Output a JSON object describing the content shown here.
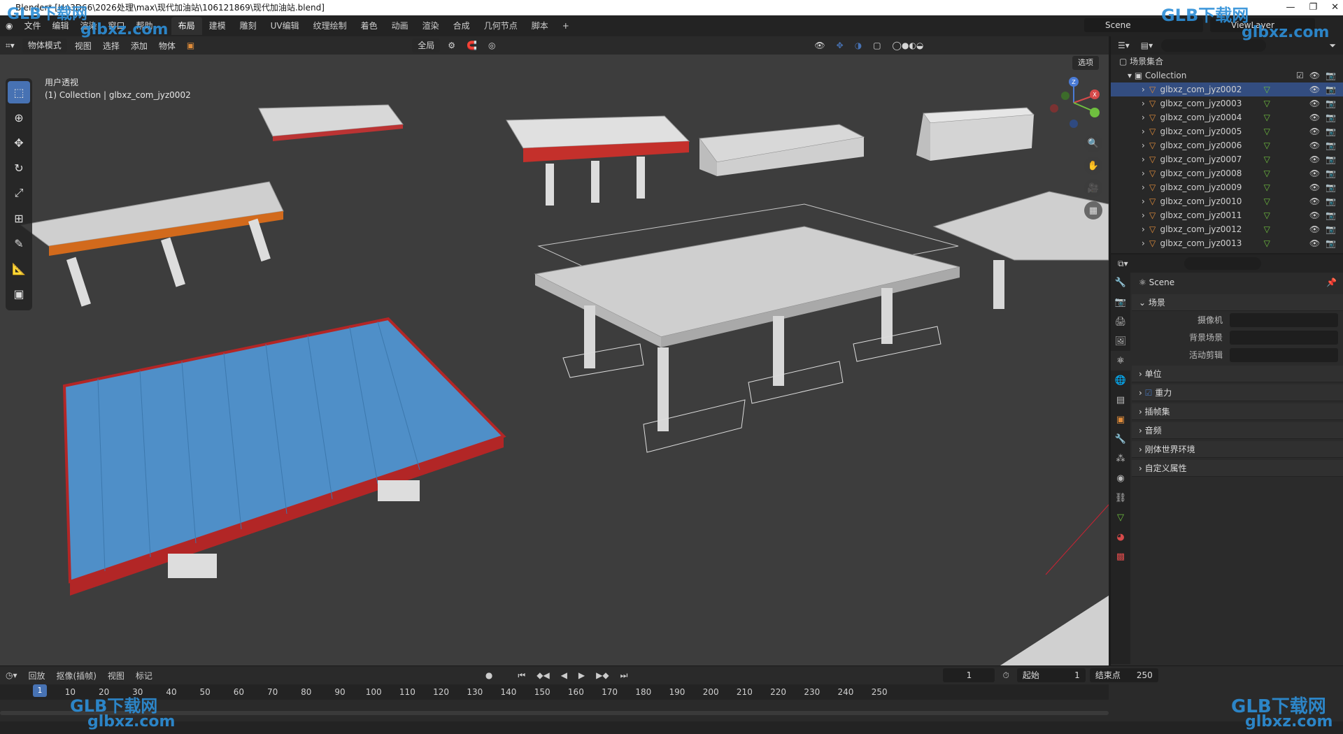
{
  "window": {
    "title": "Blender* [H:\\3D66\\2026处理\\max\\现代加油站\\106121869\\现代加油站.blend]"
  },
  "menu": [
    "文件",
    "编辑",
    "渲染",
    "窗口",
    "帮助"
  ],
  "workspaces": [
    "布局",
    "建模",
    "雕刻",
    "UV编辑",
    "纹理绘制",
    "着色",
    "动画",
    "渲染",
    "合成",
    "几何节点",
    "脚本"
  ],
  "active_workspace": "布局",
  "scene_name": "Scene",
  "view_layer": "ViewLayer",
  "viewport": {
    "mode": "物体模式",
    "menus": [
      "视图",
      "选择",
      "添加",
      "物体"
    ],
    "transform_orientation": "全局",
    "options_label": "选项",
    "info_line1": "用户透视",
    "info_line2": "(1) Collection | glbxz_com_jyz0002"
  },
  "outliner": {
    "root": "场景集合",
    "collection": "Collection",
    "items": [
      "glbxz_com_jyz0002",
      "glbxz_com_jyz0003",
      "glbxz_com_jyz0004",
      "glbxz_com_jyz0005",
      "glbxz_com_jyz0006",
      "glbxz_com_jyz0007",
      "glbxz_com_jyz0008",
      "glbxz_com_jyz0009",
      "glbxz_com_jyz0010",
      "glbxz_com_jyz0011",
      "glbxz_com_jyz0012",
      "glbxz_com_jyz0013"
    ],
    "selected_index": 0
  },
  "properties": {
    "context": "Scene",
    "panel_scene": "场景",
    "camera_label": "摄像机",
    "bg_scene_label": "背景场景",
    "active_clip_label": "活动剪辑",
    "panels": [
      "单位",
      "重力",
      "插帧集",
      "音频",
      "刚体世界环境",
      "自定义属性"
    ]
  },
  "timeline": {
    "menus": [
      "回放",
      "抠像(插帧)",
      "视图",
      "标记"
    ],
    "current_frame": "1",
    "start_label": "起始",
    "start": "1",
    "end_label": "结束点",
    "end": "250",
    "ticks": [
      "10",
      "20",
      "30",
      "40",
      "50",
      "60",
      "70",
      "80",
      "90",
      "100",
      "110",
      "120",
      "130",
      "140",
      "150",
      "160",
      "170",
      "180",
      "190",
      "200",
      "210",
      "220",
      "230",
      "240",
      "250"
    ]
  },
  "watermark": {
    "brand": "GLB下载网",
    "url": "glbxz.com"
  },
  "colors": {
    "accent": "#4772b3",
    "viewport_bg": "#3d3d3d",
    "selected_row": "#334d80"
  }
}
